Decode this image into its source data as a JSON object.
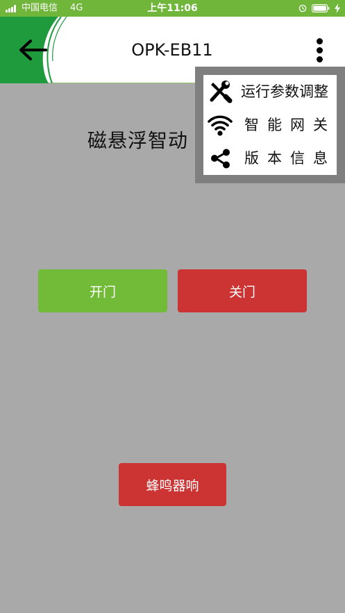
{
  "status_bar": {
    "carrier": "中国电信",
    "network": "4G",
    "time": "上午11:06"
  },
  "header": {
    "title": "OPK-EB11"
  },
  "main": {
    "device_name": "磁悬浮智动",
    "open_button": "开门",
    "close_button": "关门",
    "buzzer_button": "蜂鸣器响"
  },
  "menu": {
    "items": [
      {
        "label": "运行参数调整",
        "icon": "tools-icon"
      },
      {
        "label": "智能网关",
        "icon": "wifi-icon"
      },
      {
        "label": "版本信息",
        "icon": "share-icon"
      }
    ]
  },
  "colors": {
    "status_bar": "#6fb63a",
    "header_accent": "#1f9a3c",
    "open_button": "#72bb38",
    "close_button": "#cc3333",
    "background": "#a9a9a9"
  }
}
